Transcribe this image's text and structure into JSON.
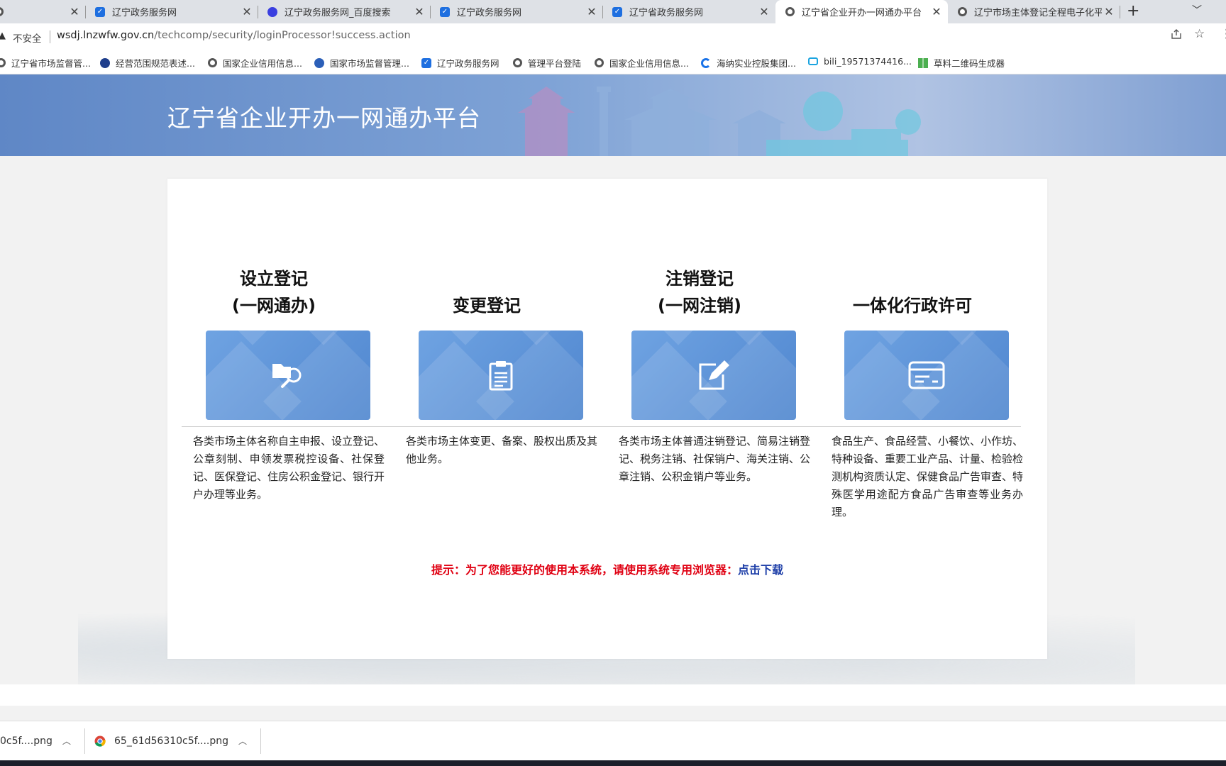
{
  "tabs": [
    {
      "title": "",
      "favicon": "globe-icon",
      "active": false
    },
    {
      "title": "辽宁政务服务网",
      "favicon": "shield-icon",
      "active": false
    },
    {
      "title": "辽宁政务服务网_百度搜索",
      "favicon": "baidu-paw-icon",
      "active": false
    },
    {
      "title": "辽宁政务服务网",
      "favicon": "shield-icon",
      "active": false
    },
    {
      "title": "辽宁省政务服务网",
      "favicon": "shield-icon",
      "active": false
    },
    {
      "title": "辽宁省企业开办一网通办平台",
      "favicon": "globe-icon",
      "active": true
    },
    {
      "title": "辽宁市场主体登记全程电子化平",
      "favicon": "globe-icon",
      "active": false
    }
  ],
  "address_bar": {
    "security_label": "不安全",
    "url_host": "wsdj.lnzwfw.gov.cn",
    "url_path": "/techcomp/security/loginProcessor!success.action"
  },
  "bookmarks": [
    {
      "label": "辽宁省市场监督管...",
      "icon": "globe-icon"
    },
    {
      "label": "经营范围规范表述...",
      "icon": "badge-icon"
    },
    {
      "label": "国家企业信用信息...",
      "icon": "globe-icon"
    },
    {
      "label": "国家市场监督管理...",
      "icon": "emblem-icon"
    },
    {
      "label": "辽宁政务服务网",
      "icon": "shield-icon"
    },
    {
      "label": "管理平台登陆",
      "icon": "globe-icon"
    },
    {
      "label": "国家企业信用信息...",
      "icon": "globe-icon"
    },
    {
      "label": "海纳实业控股集团...",
      "icon": "c-logo-icon"
    },
    {
      "label": "bili_19571374416...",
      "icon": "bilibili-icon"
    },
    {
      "label": "草料二维码生成器",
      "icon": "qr-icon"
    }
  ],
  "header": {
    "title": "辽宁省企业开办一网通办平台"
  },
  "services": [
    {
      "title_line1": "设立登记",
      "title_line2": "(一网通办)",
      "icon": "folder-search-icon",
      "description": "各类市场主体名称自主申报、设立登记、公章刻制、申领发票税控设备、社保登记、医保登记、住房公积金登记、银行开户办理等业务。"
    },
    {
      "title_line1": "",
      "title_line2": "变更登记",
      "icon": "clipboard-icon",
      "description": "各类市场主体变更、备案、股权出质及其他业务。"
    },
    {
      "title_line1": "注销登记",
      "title_line2": "(一网注销)",
      "icon": "edit-pen-icon",
      "description": "各类市场主体普通注销登记、简易注销登记、税务注销、社保销户、海关注销、公章注销、公积金销户等业务。"
    },
    {
      "title_line1": "",
      "title_line2": "一体化行政许可",
      "icon": "card-icon",
      "description": "食品生产、食品经营、小餐饮、小作坊、特种设备、重要工业产品、计量、检验检测机构资质认定、保健食品广告审查、特殊医学用途配方食品广告审查等业务办理。"
    }
  ],
  "tip": {
    "text": "提示：为了您能更好的使用本系统，请使用系统专用浏览器：",
    "link": "点击下载"
  },
  "downloads": [
    {
      "name": "0c5f....png"
    },
    {
      "name": "65_61d56310c5f....png"
    }
  ],
  "colors": {
    "accent": "#4f86cf",
    "tip_red": "#e00012",
    "link_blue": "#1e3fa8"
  }
}
